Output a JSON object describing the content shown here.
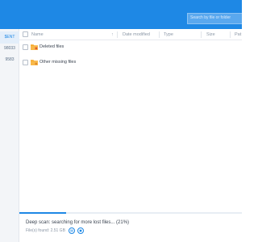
{
  "header": {
    "search_placeholder": "Search by file or folder"
  },
  "sidebar": {
    "items": [
      {
        "label": "$ENT"
      },
      {
        "label": "98033"
      },
      {
        "label": "9583"
      }
    ]
  },
  "table": {
    "columns": [
      {
        "label": "Name"
      },
      {
        "label": "Date modified"
      },
      {
        "label": "Type"
      },
      {
        "label": "Size"
      },
      {
        "label": "Pat"
      }
    ],
    "sort_indicator": "↑",
    "rows": [
      {
        "label": "Deleted files",
        "icon": "folder-deleted-icon"
      },
      {
        "label": "Other missing files",
        "icon": "folder-missing-icon"
      }
    ]
  },
  "status": {
    "message": "Deep scan: searching for more lost files... (21%)",
    "progress_percent": 21,
    "found": "File(s) found: 2.51 GB",
    "pause_icon": "pause-icon",
    "stop_icon": "stop-icon"
  },
  "colors": {
    "accent": "#1e88e5",
    "folder": "#f5a623"
  }
}
